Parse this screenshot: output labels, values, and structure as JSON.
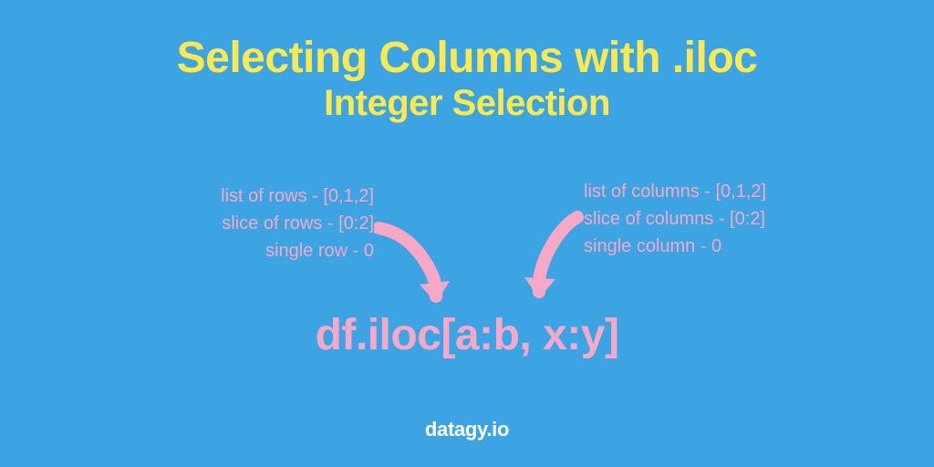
{
  "title": "Selecting Columns with .iloc",
  "subtitle": "Integer Selection",
  "code": "df.iloc[a:b, x:y]",
  "annotations": {
    "left": [
      "list of rows - [0,1,2]",
      "slice of rows - [0:2]",
      "single row - 0"
    ],
    "right": [
      "list of columns - [0,1,2]",
      "slice of columns - [0:2]",
      "single column - 0"
    ]
  },
  "brand": "datagy.io",
  "colors": {
    "bg": "#3da4e4",
    "yellow": "#fce94f",
    "pink": "#f6a8c6",
    "white": "#ffffff"
  }
}
